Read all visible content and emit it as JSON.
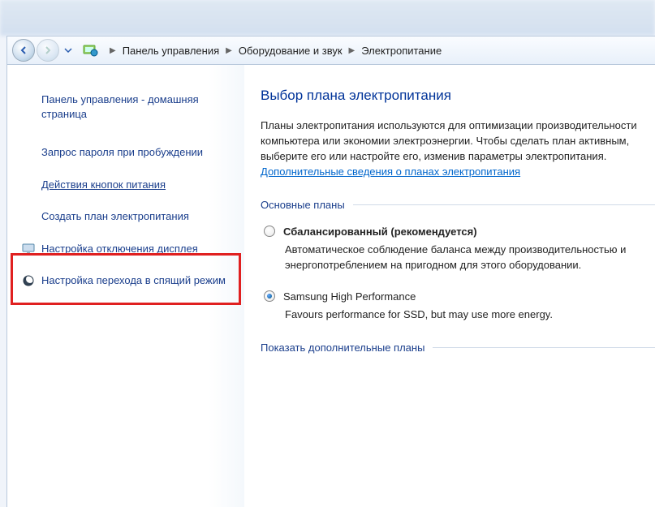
{
  "breadcrumb": {
    "items": [
      "Панель управления",
      "Оборудование и звук",
      "Электропитание"
    ]
  },
  "sidebar": {
    "home": "Панель управления - домашняя страница",
    "items": [
      {
        "label": "Запрос пароля при пробуждении"
      },
      {
        "label": "Действия кнопок питания",
        "underline": true
      },
      {
        "label": "Создать план электропитания"
      },
      {
        "label": "Настройка отключения дисплея",
        "icon": "monitor"
      },
      {
        "label": "Настройка перехода в спящий режим",
        "icon": "moon"
      }
    ]
  },
  "main": {
    "heading": "Выбор плана электропитания",
    "intro_text": "Планы электропитания используются для оптимизации производительности компьютера или экономии электроэнергии. Чтобы сделать план активным, выберите его или настройте его, изменив параметры электропитания. ",
    "intro_link": "Дополнительные сведения о планах электропитания",
    "group1": "Основные планы",
    "plans": [
      {
        "name": "Сбалансированный (рекомендуется)",
        "desc": "Автоматическое соблюдение баланса между производительностью и энергопотреблением на пригодном для этого оборудовании.",
        "checked": false
      },
      {
        "name": "Samsung High Performance",
        "desc": "Favours performance for SSD, but may use more energy.",
        "checked": true
      }
    ],
    "group2": "Показать дополнительные планы"
  }
}
